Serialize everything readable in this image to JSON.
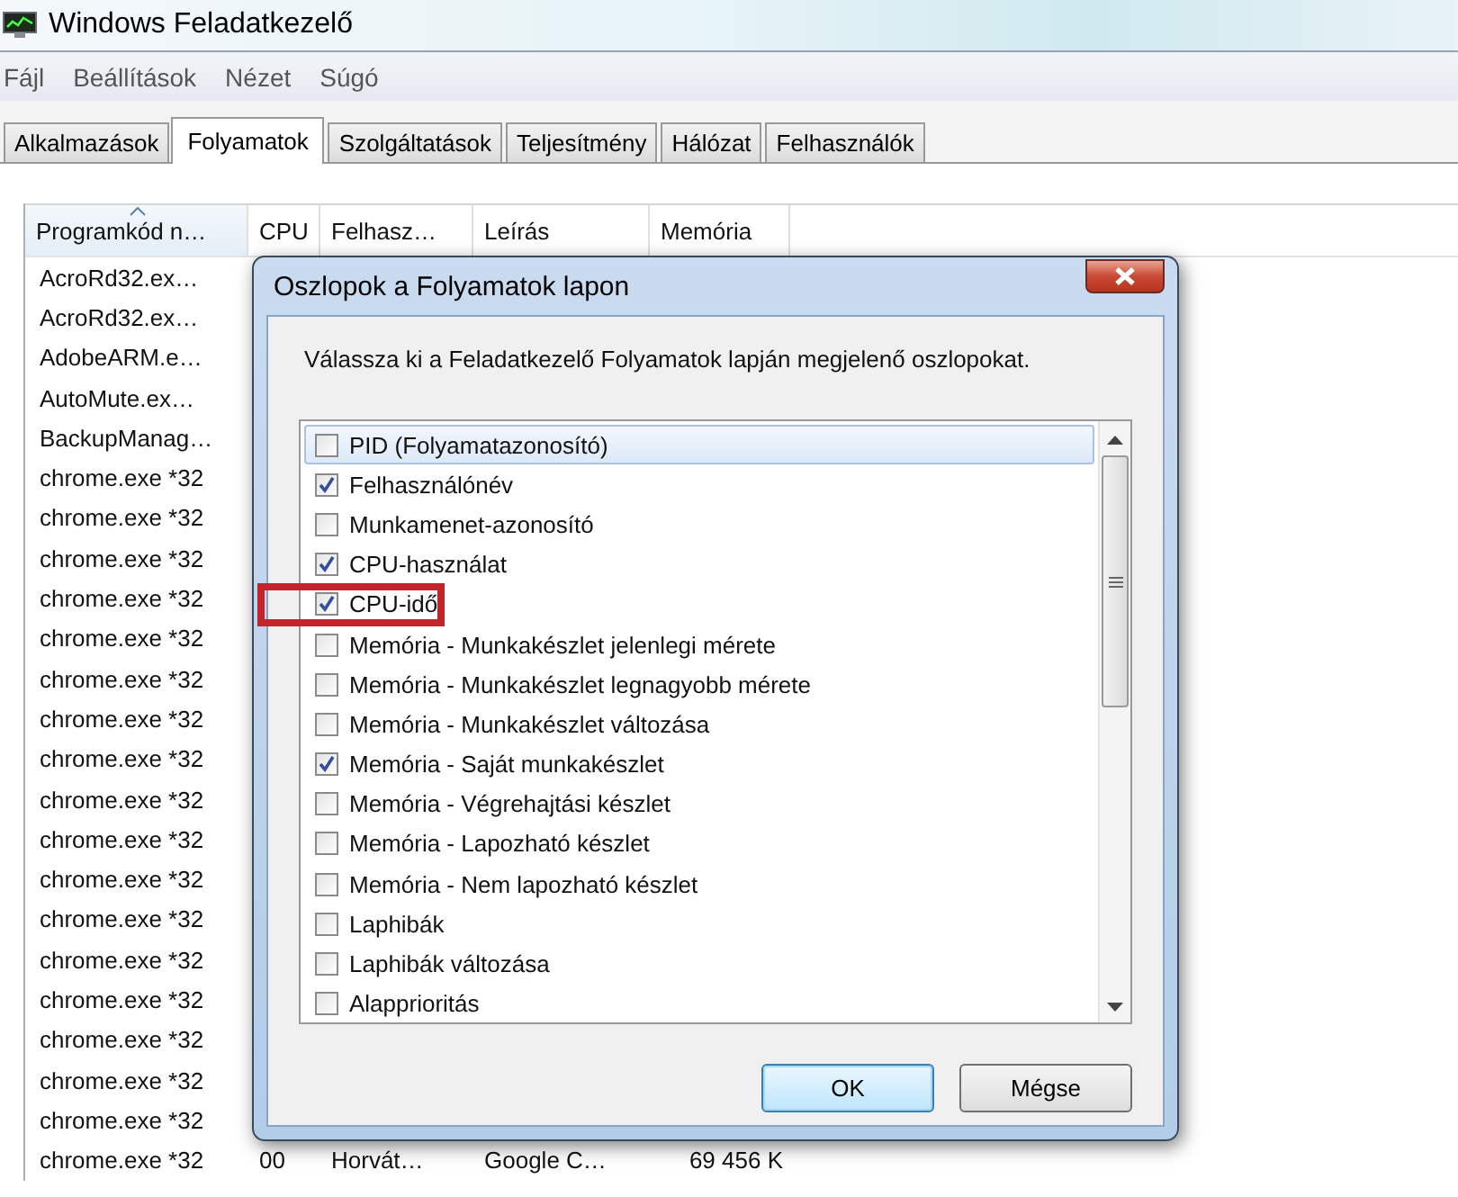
{
  "window": {
    "title": "Windows Feladatkezelő"
  },
  "menu": [
    "Fájl",
    "Beállítások",
    "Nézet",
    "Súgó"
  ],
  "tabs": [
    {
      "label": "Alkalmazások",
      "selected": false
    },
    {
      "label": "Folyamatok",
      "selected": true
    },
    {
      "label": "Szolgáltatások",
      "selected": false
    },
    {
      "label": "Teljesítmény",
      "selected": false
    },
    {
      "label": "Hálózat",
      "selected": false
    },
    {
      "label": "Felhasználók",
      "selected": false
    }
  ],
  "table": {
    "columns": [
      {
        "label": "Programkód n…",
        "sorted": true
      },
      {
        "label": "CPU",
        "sorted": false
      },
      {
        "label": "Felhasz…",
        "sorted": false
      },
      {
        "label": "Leírás",
        "sorted": false
      },
      {
        "label": "Memória",
        "sorted": false
      }
    ],
    "rows": [
      {
        "name": "AcroRd32.ex…"
      },
      {
        "name": "AcroRd32.ex…"
      },
      {
        "name": "AdobeARM.e…"
      },
      {
        "name": "AutoMute.ex…"
      },
      {
        "name": "BackupManag…"
      },
      {
        "name": "chrome.exe *32"
      },
      {
        "name": "chrome.exe *32"
      },
      {
        "name": "chrome.exe *32"
      },
      {
        "name": "chrome.exe *32"
      },
      {
        "name": "chrome.exe *32"
      },
      {
        "name": "chrome.exe *32"
      },
      {
        "name": "chrome.exe *32"
      },
      {
        "name": "chrome.exe *32"
      },
      {
        "name": "chrome.exe *32"
      },
      {
        "name": "chrome.exe *32"
      },
      {
        "name": "chrome.exe *32"
      },
      {
        "name": "chrome.exe *32"
      },
      {
        "name": "chrome.exe *32"
      },
      {
        "name": "chrome.exe *32"
      },
      {
        "name": "chrome.exe *32"
      },
      {
        "name": "chrome.exe *32"
      },
      {
        "name": "chrome.exe *32"
      },
      {
        "name": "chrome.exe *32",
        "cpu": "00",
        "user": "Horvát…",
        "description": "Google C…",
        "memory": "69 456 K"
      }
    ]
  },
  "dialog": {
    "title": "Oszlopok a Folyamatok lapon",
    "instruction": "Válassza ki a Feladatkezelő Folyamatok lapján megjelenő oszlopokat.",
    "options": [
      {
        "label": "PID (Folyamatazonosító)",
        "checked": false,
        "selected": true,
        "annotated": false
      },
      {
        "label": "Felhasználónév",
        "checked": true,
        "selected": false,
        "annotated": false
      },
      {
        "label": "Munkamenet-azonosító",
        "checked": false,
        "selected": false,
        "annotated": false
      },
      {
        "label": "CPU-használat",
        "checked": true,
        "selected": false,
        "annotated": false
      },
      {
        "label": "CPU-idő",
        "checked": true,
        "selected": false,
        "annotated": true
      },
      {
        "label": "Memória - Munkakészlet jelenlegi mérete",
        "checked": false,
        "selected": false,
        "annotated": false
      },
      {
        "label": "Memória - Munkakészlet legnagyobb mérete",
        "checked": false,
        "selected": false,
        "annotated": false
      },
      {
        "label": "Memória - Munkakészlet változása",
        "checked": false,
        "selected": false,
        "annotated": false
      },
      {
        "label": "Memória - Saját munkakészlet",
        "checked": true,
        "selected": false,
        "annotated": false
      },
      {
        "label": "Memória - Végrehajtási készlet",
        "checked": false,
        "selected": false,
        "annotated": false
      },
      {
        "label": "Memória - Lapozható készlet",
        "checked": false,
        "selected": false,
        "annotated": false
      },
      {
        "label": "Memória - Nem lapozható készlet",
        "checked": false,
        "selected": false,
        "annotated": false
      },
      {
        "label": "Laphibák",
        "checked": false,
        "selected": false,
        "annotated": false
      },
      {
        "label": "Laphibák változása",
        "checked": false,
        "selected": false,
        "annotated": false
      },
      {
        "label": "Alapprioritás",
        "checked": false,
        "selected": false,
        "annotated": false
      }
    ],
    "buttons": [
      {
        "label": "OK",
        "default": true
      },
      {
        "label": "Mégse",
        "default": false
      }
    ]
  }
}
